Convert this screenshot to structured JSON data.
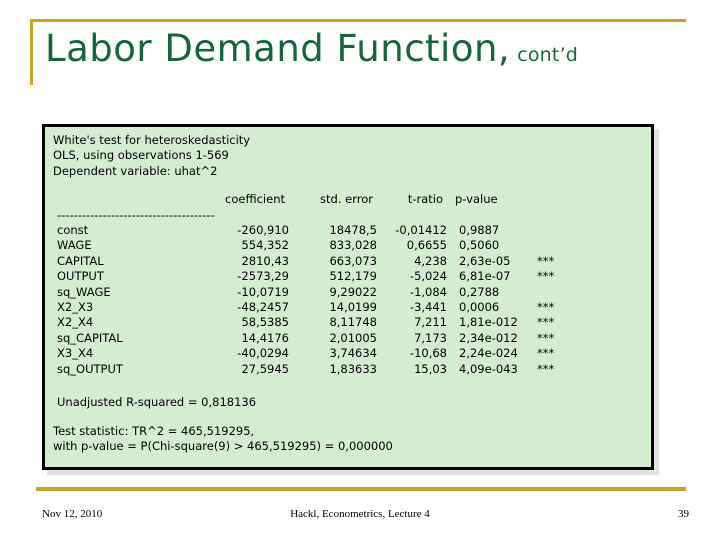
{
  "slide": {
    "title": "Labor Demand Function,",
    "subtitle": "cont’d",
    "accent_color": "#c9a227",
    "title_color": "#16653c",
    "box_fill_color": "#d6ecd1"
  },
  "output": {
    "header_lines": [
      "White's test for heteroskedasticity",
      "OLS, using observations 1-569",
      "Dependent variable: uhat^2"
    ],
    "columns": {
      "coefficient": "coefficient",
      "std_error": "std. error",
      "t_ratio": "t-ratio",
      "p_value": "p-value"
    },
    "separator": "--------------------------------------",
    "rows": [
      {
        "name": "const",
        "coefficient": "-260,910",
        "std_error": "18478,5",
        "t_ratio": "-0,01412",
        "p_value": "0,9887",
        "stars": ""
      },
      {
        "name": "WAGE",
        "coefficient": "554,352",
        "std_error": "833,028",
        "t_ratio": "0,6655",
        "p_value": "0,5060",
        "stars": ""
      },
      {
        "name": "CAPITAL",
        "coefficient": "2810,43",
        "std_error": "663,073",
        "t_ratio": "4,238",
        "p_value": "2,63e-05",
        "stars": "***"
      },
      {
        "name": "OUTPUT",
        "coefficient": "-2573,29",
        "std_error": "512,179",
        "t_ratio": "-5,024",
        "p_value": "6,81e-07",
        "stars": "***"
      },
      {
        "name": "sq_WAGE",
        "coefficient": "-10,0719",
        "std_error": "9,29022",
        "t_ratio": "-1,084",
        "p_value": "0,2788",
        "stars": ""
      },
      {
        "name": "X2_X3",
        "coefficient": "-48,2457",
        "std_error": "14,0199",
        "t_ratio": "-3,441",
        "p_value": "0,0006",
        "stars": "***"
      },
      {
        "name": "X2_X4",
        "coefficient": "58,5385",
        "std_error": "8,11748",
        "t_ratio": "7,211",
        "p_value": "1,81e-012",
        "stars": "***"
      },
      {
        "name": "sq_CAPITAL",
        "coefficient": "14,4176",
        "std_error": "2,01005",
        "t_ratio": "7,173",
        "p_value": "2,34e-012",
        "stars": "***"
      },
      {
        "name": "X3_X4",
        "coefficient": "-40,0294",
        "std_error": "3,74634",
        "t_ratio": "-10,68",
        "p_value": "2,24e-024",
        "stars": "***"
      },
      {
        "name": "sq_OUTPUT",
        "coefficient": "27,5945",
        "std_error": "1,83633",
        "t_ratio": "15,03",
        "p_value": "4,09e-043",
        "stars": "***"
      }
    ],
    "r_squared_line": "Unadjusted R-squared = 0,818136",
    "test_statistic_line": "Test statistic: TR^2 = 465,519295,",
    "test_pvalue_line": "with p-value = P(Chi-square(9) > 465,519295) = 0,000000"
  },
  "footer": {
    "date": "Nov 12, 2010",
    "center": "Hackl, Econometrics, Lecture 4",
    "page_number": "39"
  }
}
